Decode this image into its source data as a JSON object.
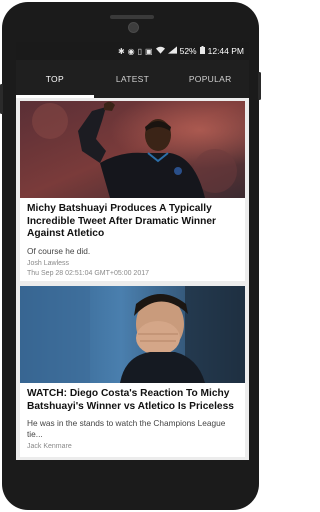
{
  "status_bar": {
    "battery": "52%",
    "time": "12:44 PM",
    "icons": [
      "bluetooth-icon",
      "location-icon",
      "vibrate-icon",
      "nfc-icon",
      "wifi-icon",
      "signal-icon",
      "battery-icon"
    ]
  },
  "tabs": [
    {
      "label": "TOP",
      "active": true
    },
    {
      "label": "LATEST",
      "active": false
    },
    {
      "label": "POPULAR",
      "active": false
    }
  ],
  "articles": [
    {
      "title": "Michy Batshuayi Produces A Typically Incredible Tweet After Dramatic Winner Against Atletico",
      "excerpt": "Of course he did.",
      "author": "Josh Lawless",
      "date": "Thu Sep 28 02:51:04 GMT+05:00 2017",
      "image": "player-celebrating-photo"
    },
    {
      "title": "WATCH: Diego Costa's Reaction To Michy Batshuayi's Winner vs Atletico Is Priceless",
      "excerpt": "He was in the stands to watch the Champions League tie...",
      "author": "Jack Kenmare",
      "image": "player-covering-face-photo"
    }
  ],
  "colors": {
    "app_bar": "#1f1f1f",
    "status_bar": "#1a1a1a",
    "background": "#ececec",
    "indicator": "#ffffff"
  }
}
